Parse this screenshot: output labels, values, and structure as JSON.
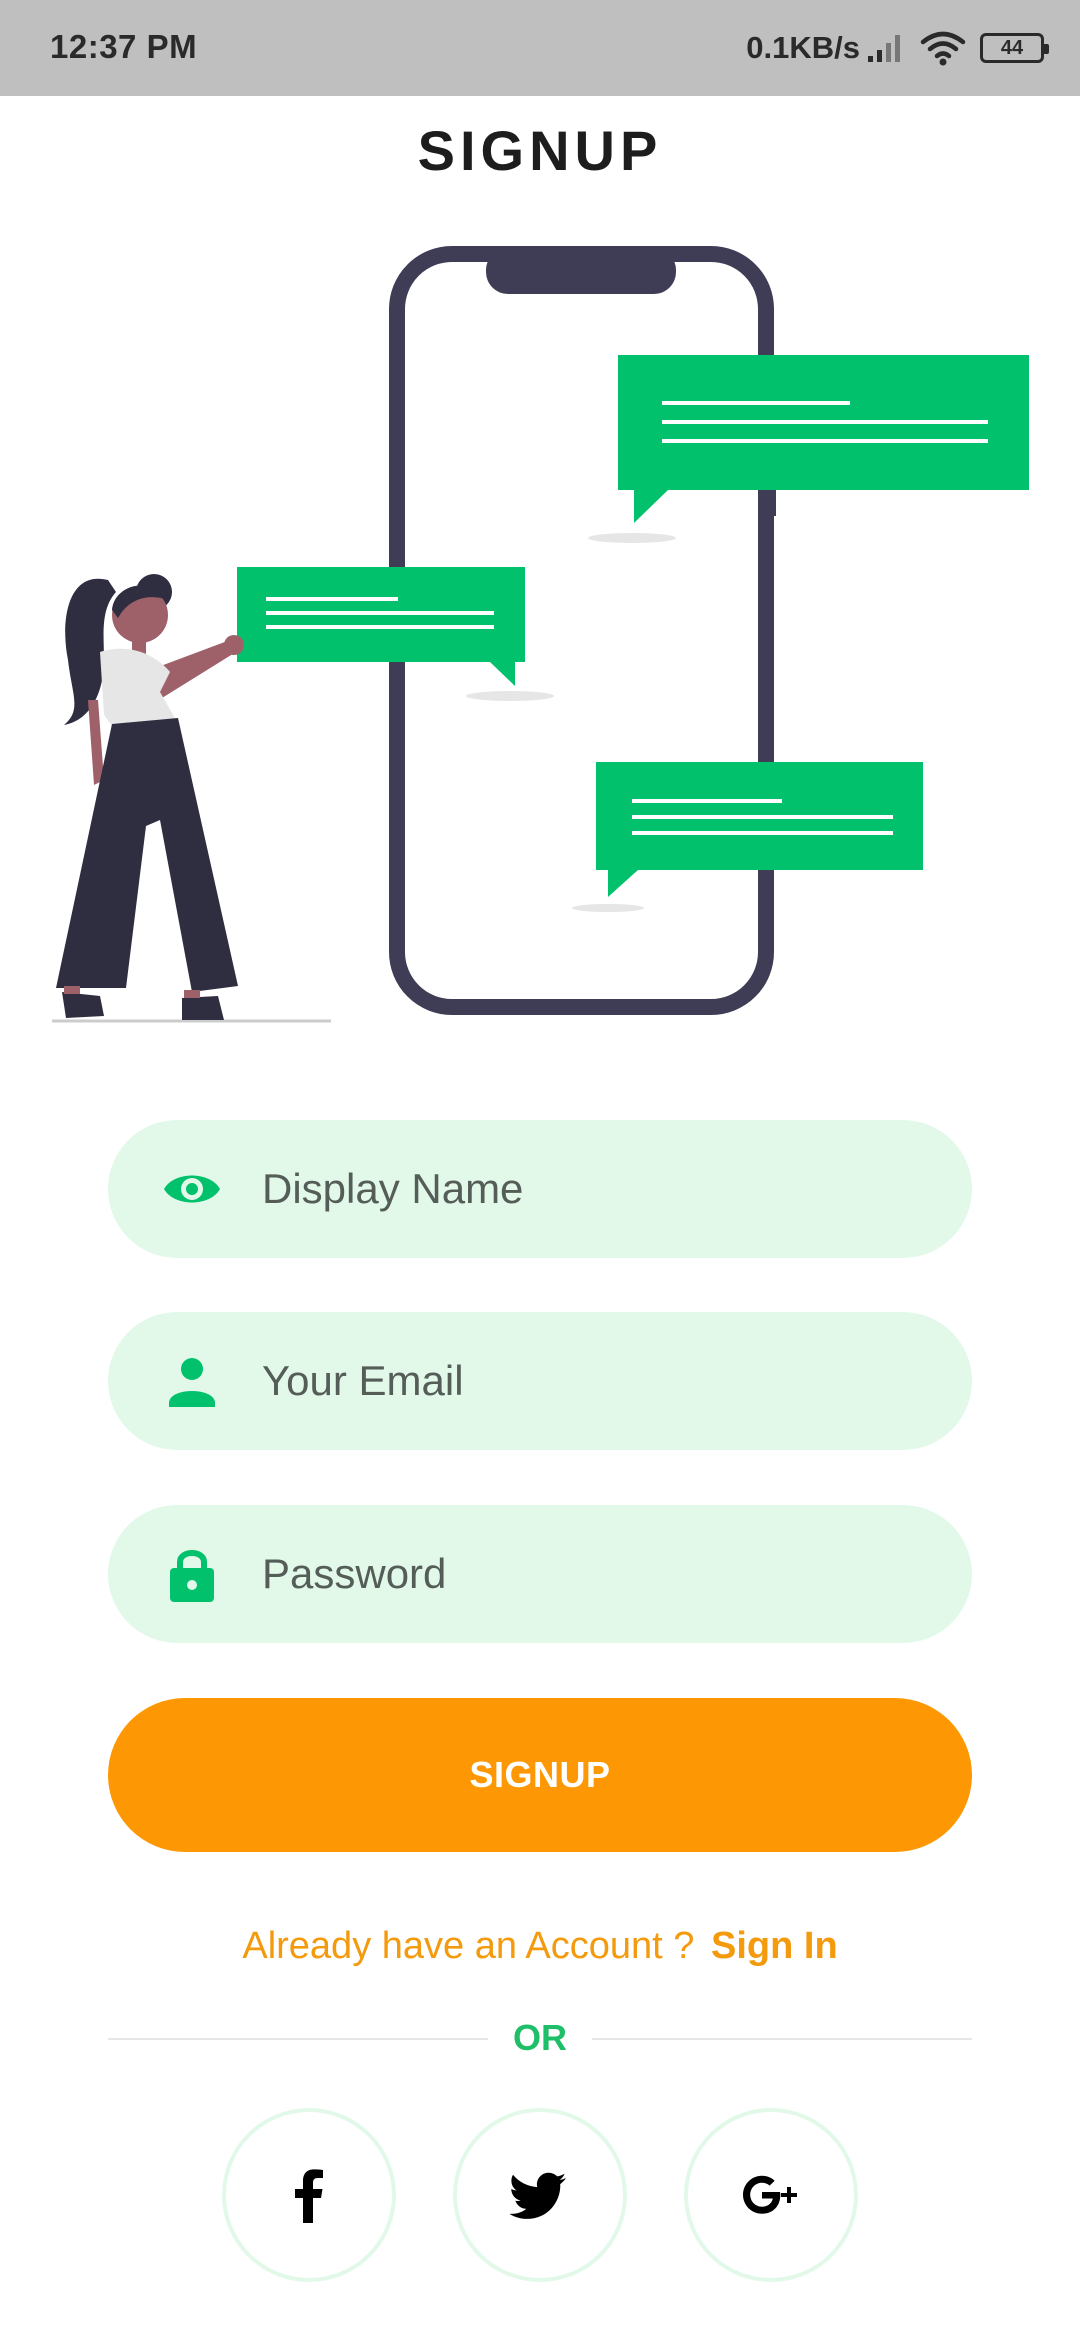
{
  "status_bar": {
    "time": "12:37 PM",
    "network_speed": "0.1KB/s",
    "battery_level": "44",
    "icons": [
      "signal-icon",
      "wifi-icon",
      "battery-icon"
    ]
  },
  "header": {
    "title": "SIGNUP"
  },
  "form": {
    "display_name": {
      "placeholder": "Display Name",
      "value": "",
      "icon": "eye-icon"
    },
    "email": {
      "placeholder": "Your Email",
      "value": "",
      "icon": "person-icon"
    },
    "password": {
      "placeholder": "Password",
      "value": "",
      "icon": "lock-icon"
    },
    "submit_label": "SIGNUP"
  },
  "account_prompt": {
    "text": "Already have an Account ? ",
    "link_label": "Sign In"
  },
  "divider_label": "OR",
  "social_buttons": [
    {
      "icon": "facebook-icon"
    },
    {
      "icon": "twitter-icon"
    },
    {
      "icon": "google-plus-icon"
    }
  ],
  "colors": {
    "primary_green": "#02c16c",
    "field_background": "#e2f9ea",
    "accent_orange": "#fd9804",
    "phone_frame": "#3f3d56",
    "status_bar": "#bfbfbf"
  }
}
